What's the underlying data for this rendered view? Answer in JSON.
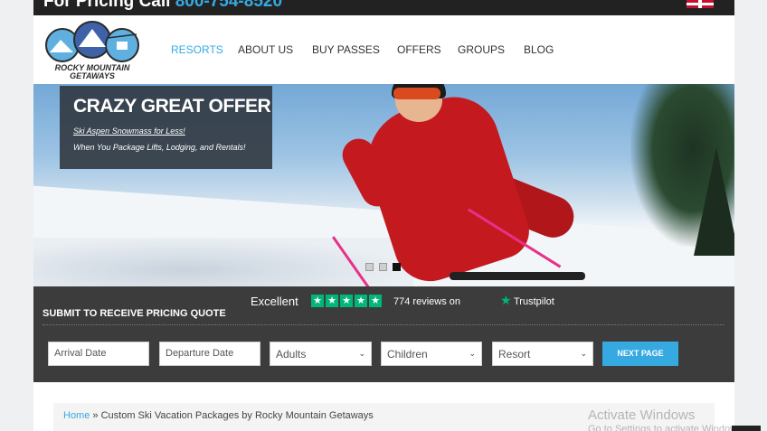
{
  "topbar": {
    "prefix": "For Pricing Call",
    "phone": "800-754-8520",
    "flag": "uk-flag-icon"
  },
  "logo": {
    "line1": "ROCKY MOUNTAIN",
    "line2": "GETAWAYS"
  },
  "nav": {
    "items": [
      {
        "label": "RESORTS",
        "active": true
      },
      {
        "label": "ABOUT US"
      },
      {
        "label": "BUY PASSES"
      },
      {
        "label": "OFFERS"
      },
      {
        "label": "GROUPS"
      },
      {
        "label": "BLOG"
      }
    ]
  },
  "hero": {
    "title": "CRAZY GREAT OFFER",
    "link": "Ski Aspen Snowmass for Less!",
    "subtitle": "When You Package Lifts, Lodging, and Rentals!",
    "slides": {
      "count": 3,
      "active": 3
    }
  },
  "trustpilot": {
    "rating_label": "Excellent",
    "stars": 5,
    "reviews": "774 reviews on",
    "brand": "Trustpilot"
  },
  "quote": {
    "title": "SUBMIT TO RECEIVE PRICING QUOTE",
    "arrival_placeholder": "Arrival Date",
    "departure_placeholder": "Departure Date",
    "adults": "Adults",
    "children": "Children",
    "resort": "Resort",
    "next": "NEXT PAGE"
  },
  "breadcrumb": {
    "home": "Home",
    "separator": "»",
    "current": "Custom Ski Vacation Packages by Rocky Mountain Getaways"
  },
  "watermark": {
    "line1": "Activate Windows",
    "line2": "Go to Settings to activate Windows."
  },
  "colors": {
    "accent": "#36a9e1",
    "trustpilot": "#00b67a",
    "dark_panel": "#3c3c3c"
  }
}
